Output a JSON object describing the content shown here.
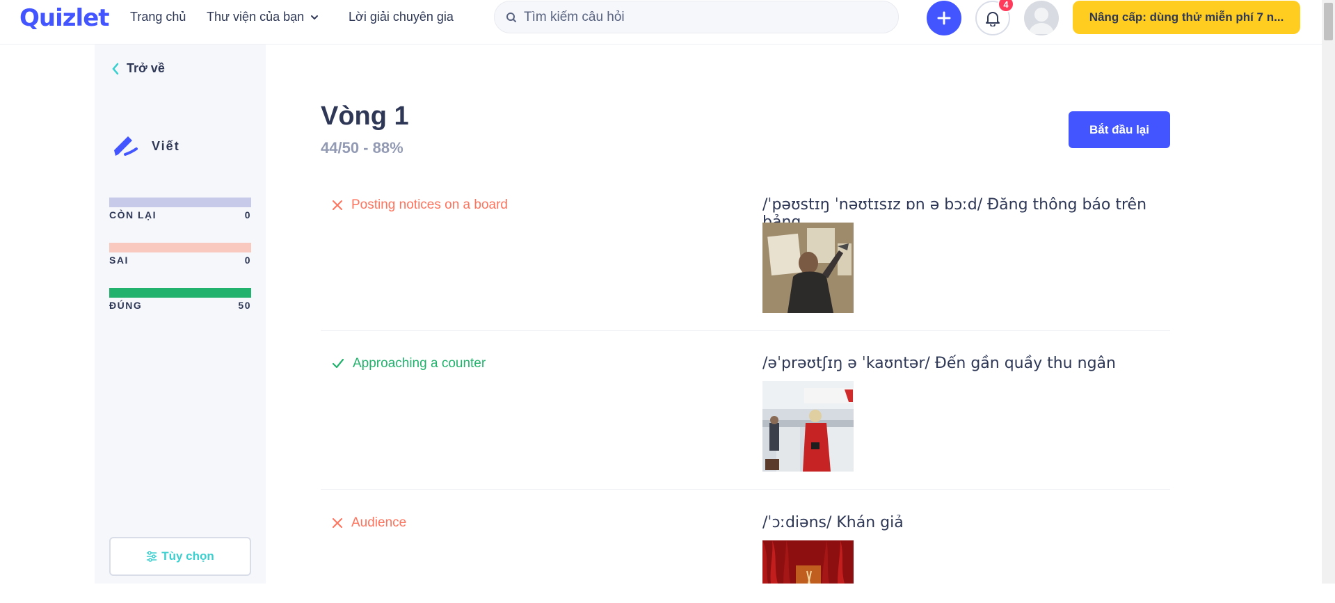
{
  "header": {
    "logo": "Quizlet",
    "nav": [
      {
        "label": "Trang chủ"
      },
      {
        "label": "Thư viện của bạn"
      },
      {
        "label": "Lời giải chuyên gia"
      }
    ],
    "search_placeholder": "Tìm kiếm câu hỏi",
    "notification_count": "4",
    "upgrade_label": "Nâng cấp: dùng thử miễn phí 7 n..."
  },
  "sidebar": {
    "back_label": "Trở về",
    "mode_label": "Viết",
    "stats": [
      {
        "label": "CÒN LẠI",
        "value": "0",
        "color": "#c7cbe9"
      },
      {
        "label": "SAI",
        "value": "0",
        "color": "#f9c9c0"
      },
      {
        "label": "ĐÚNG",
        "value": "50",
        "color": "#23b26d"
      }
    ],
    "options_label": "Tùy chọn"
  },
  "main": {
    "round_title": "Vòng 1",
    "score": "44/50 - 88%",
    "restart_label": "Bắt đầu lại",
    "results": [
      {
        "status": "wrong",
        "term": "Posting notices on a board",
        "definition": "/ˈpəʊstɪŋ ˈnəʊtɪsɪz ɒn ə bɔːd/ Đăng thông báo trên bảng"
      },
      {
        "status": "correct",
        "term": "Approaching a counter",
        "definition": "/əˈprəʊtʃɪŋ ə ˈkaʊntər/ Đến gần quầy thu ngân"
      },
      {
        "status": "wrong",
        "term": "Audience",
        "definition": "/ˈɔːdiəns/ Khán giả"
      }
    ]
  },
  "colors": {
    "brand": "#4255ff",
    "upgrade": "#ffcd1f",
    "wrong": "#ff725b",
    "correct": "#23b26d",
    "options_text": "#3ccfcf"
  }
}
